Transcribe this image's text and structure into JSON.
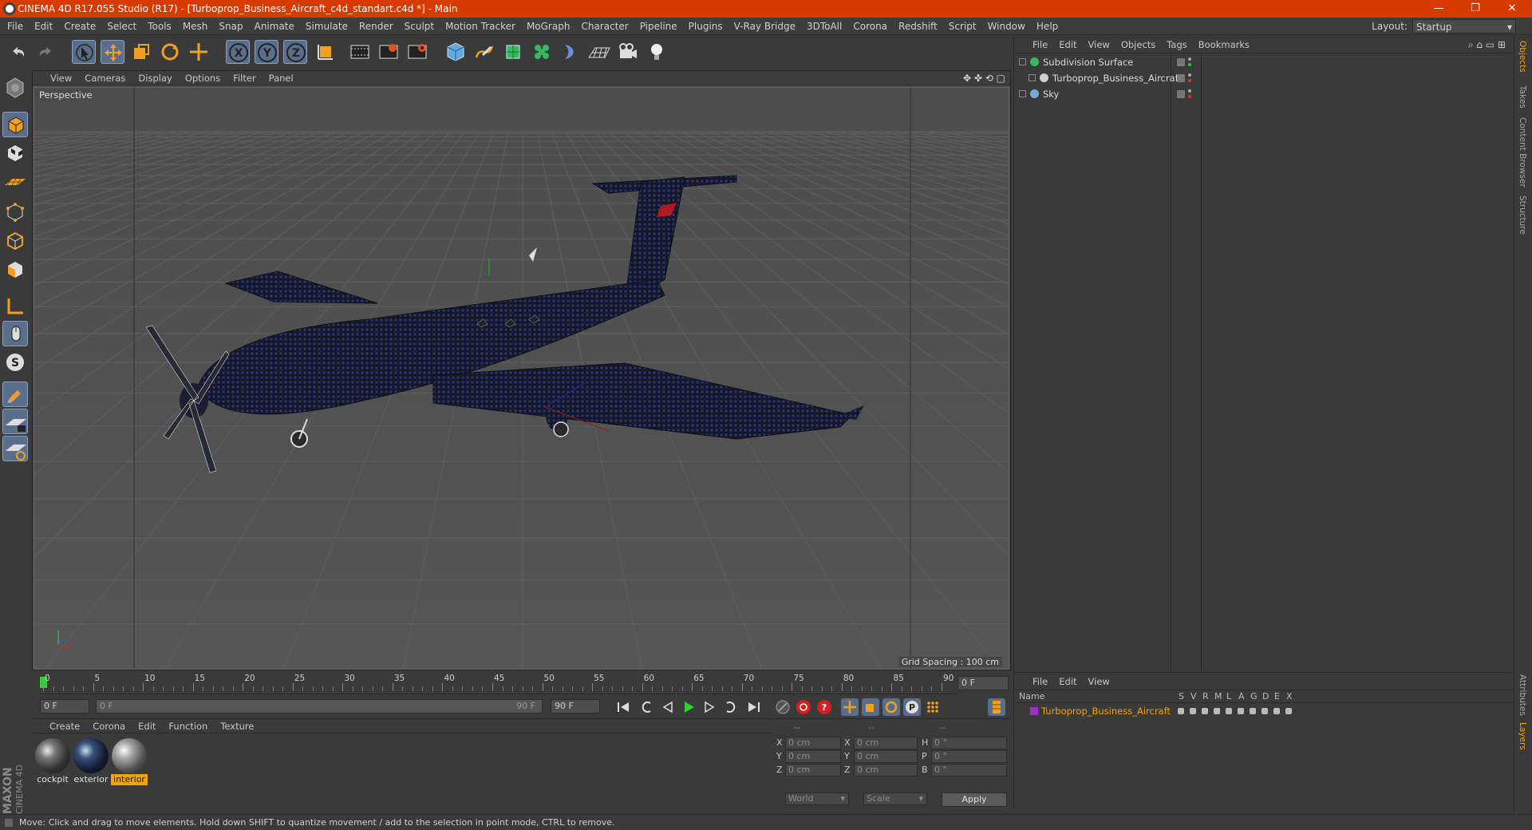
{
  "window": {
    "title": "CINEMA 4D R17.055 Studio (R17) - [Turboprop_Business_Aircraft_c4d_standart.c4d *] - Main",
    "minimize": "—",
    "maximize": "❐",
    "close": "✕"
  },
  "menubar": {
    "items": [
      "File",
      "Edit",
      "Create",
      "Select",
      "Tools",
      "Mesh",
      "Snap",
      "Animate",
      "Simulate",
      "Render",
      "Sculpt",
      "Motion Tracker",
      "MoGraph",
      "Character",
      "Pipeline",
      "Plugins",
      "V-Ray Bridge",
      "3DToAll",
      "Corona",
      "Redshift",
      "Script",
      "Window",
      "Help"
    ],
    "layout_label": "Layout:",
    "layout_value": "Startup"
  },
  "toolbar": {
    "axis_x": "X",
    "axis_y": "Y",
    "axis_z": "Z",
    "icons": [
      "undo-icon",
      "redo-icon",
      "select-arrow-icon",
      "move-icon",
      "scale-icon",
      "rotate-icon",
      "live-move-icon",
      "x-axis-icon",
      "y-axis-icon",
      "z-axis-icon",
      "coordinate-system-icon",
      "render-view-icon",
      "render-picture-viewer-icon",
      "edit-render-settings-icon",
      "cube-icon",
      "pen-spline-icon",
      "subdivision-icon",
      "cloner-icon",
      "deformer-icon",
      "floor-icon",
      "camera-icon",
      "light-icon"
    ]
  },
  "viewport": {
    "menu": [
      "View",
      "Cameras",
      "Display",
      "Options",
      "Filter",
      "Panel"
    ],
    "camera_label": "Perspective",
    "grid_spacing": "Grid Spacing : 100 cm"
  },
  "timeline": {
    "ticks": [
      "0",
      "5",
      "10",
      "15",
      "20",
      "25",
      "30",
      "35",
      "40",
      "45",
      "50",
      "55",
      "60",
      "65",
      "70",
      "75",
      "80",
      "85",
      "90"
    ],
    "current_frame_field": "0 F",
    "start_field": "0 F",
    "range_start": "0 F",
    "range_end": "90 F",
    "end_field": "90 F"
  },
  "materials": {
    "menu": [
      "Create",
      "Corona",
      "Edit",
      "Function",
      "Texture"
    ],
    "items": [
      {
        "name": "cockpit",
        "selected": false
      },
      {
        "name": "exterior",
        "selected": false
      },
      {
        "name": "interior",
        "selected": true
      }
    ]
  },
  "maxon": {
    "line1": "MAXON",
    "line2": "CINEMA 4D"
  },
  "coords": {
    "headers": [
      "--",
      "--",
      "--"
    ],
    "rows": [
      {
        "l1": "X",
        "v1": "0 cm",
        "l2": "X",
        "v2": "0 cm",
        "l3": "H",
        "v3": "0 °"
      },
      {
        "l1": "Y",
        "v1": "0 cm",
        "l2": "Y",
        "v2": "0 cm",
        "l3": "P",
        "v3": "0 °"
      },
      {
        "l1": "Z",
        "v1": "0 cm",
        "l2": "Z",
        "v2": "0 cm",
        "l3": "B",
        "v3": "0 °"
      }
    ],
    "mode": "World",
    "type": "Scale",
    "apply": "Apply"
  },
  "objects": {
    "menu": [
      "File",
      "Edit",
      "View",
      "Objects",
      "Tags",
      "Bookmarks"
    ],
    "tree": [
      {
        "name": "Subdivision Surface",
        "indent": 0,
        "icon": "subdivision-icon"
      },
      {
        "name": "Turboprop_Business_Aircraft",
        "indent": 1,
        "icon": "null-object-icon"
      },
      {
        "name": "Sky",
        "indent": 0,
        "icon": "sky-icon"
      }
    ]
  },
  "layers": {
    "menu": [
      "File",
      "Edit",
      "View"
    ],
    "header_name": "Name",
    "columns": [
      "S",
      "V",
      "R",
      "M",
      "L",
      "A",
      "G",
      "D",
      "E",
      "X"
    ],
    "rows": [
      {
        "name": "Turboprop_Business_Aircraft",
        "color": "#9b30c8"
      }
    ]
  },
  "sidetabs": {
    "top": [
      "Objects",
      "Takes",
      "Content Browser",
      "Structure"
    ],
    "bottom": [
      "Attributes",
      "Layers"
    ]
  },
  "status": "Move: Click and drag to move elements. Hold down SHIFT to quantize movement / add to the selection in point mode, CTRL to remove.",
  "colors": {
    "accent": "#f4a20b",
    "titlebar": "#d83b01",
    "highlight": "#5a6e8c"
  }
}
